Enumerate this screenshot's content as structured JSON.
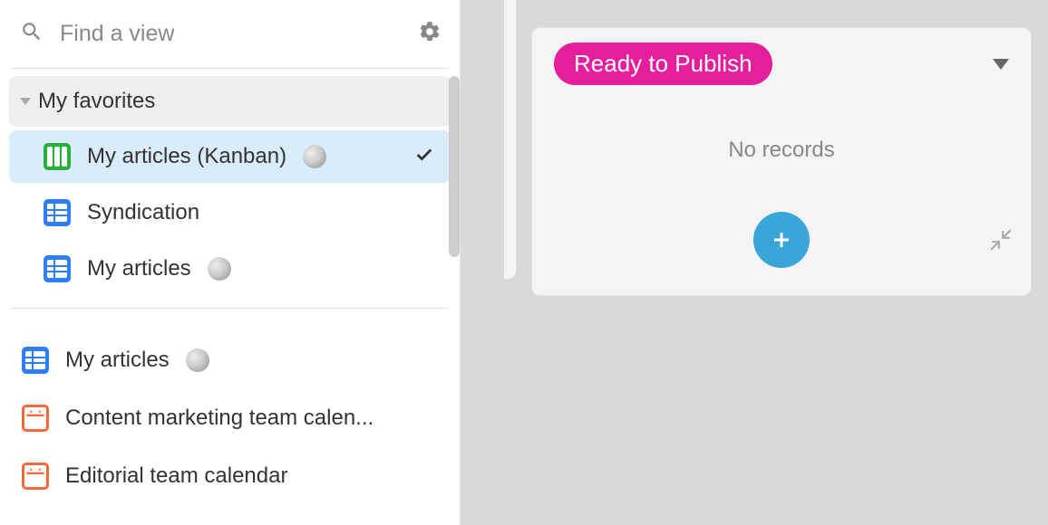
{
  "search": {
    "placeholder": "Find a view"
  },
  "sidebar": {
    "favorites_label": "My favorites",
    "favorites": [
      {
        "label": "My articles (Kanban)",
        "icon": "kanban",
        "has_avatar": true,
        "active": true,
        "checked": true
      },
      {
        "label": "Syndication",
        "icon": "grid-blue",
        "has_avatar": false,
        "active": false,
        "checked": false
      },
      {
        "label": "My articles",
        "icon": "grid-blue",
        "has_avatar": true,
        "active": false,
        "checked": false
      }
    ],
    "views": [
      {
        "label": "My articles",
        "icon": "grid-blue",
        "has_avatar": true
      },
      {
        "label": "Content marketing team calen...",
        "icon": "calendar-orange",
        "has_avatar": false
      },
      {
        "label": "Editorial team calendar",
        "icon": "calendar-orange",
        "has_avatar": false
      }
    ]
  },
  "kanban": {
    "column": {
      "status_label": "Ready to Publish",
      "status_color": "#e51e9c",
      "empty_text": "No records"
    }
  }
}
